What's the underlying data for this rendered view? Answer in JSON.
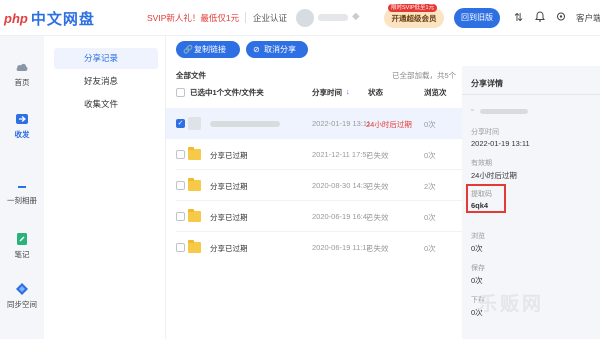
{
  "header": {
    "logo_php": "php",
    "logo_text": "中文网盘",
    "svip_promo": "SVIP新人礼！最低仅1元",
    "cert_label": "企业认证",
    "vip_button": "开通超级会员",
    "vip_tag": "限时SVIP低至1元",
    "back_button": "回到旧版",
    "client_label": "客户端"
  },
  "leftnav": {
    "items": [
      {
        "label": "首页",
        "icon": "cloud-icon"
      },
      {
        "label": "收发",
        "icon": "share-icon"
      },
      {
        "label": "一刻相册",
        "icon": "photo-icon"
      },
      {
        "label": "笔记",
        "icon": "note-icon"
      },
      {
        "label": "同步空间",
        "icon": "sync-icon"
      }
    ]
  },
  "subnav": {
    "items": [
      {
        "label": "分享记录",
        "active": true
      },
      {
        "label": "好友消息"
      },
      {
        "label": "收集文件"
      }
    ]
  },
  "toolbar": {
    "copy_link": "复制链接",
    "cancel_share": "取消分享"
  },
  "list": {
    "section_title": "全部文件",
    "loaded_text": "已全部加载，共5个",
    "headers": {
      "name": "已选中1个文件/文件夹",
      "time": "分享时间",
      "status": "状态",
      "views": "浏览次"
    },
    "rows": [
      {
        "name": "",
        "time": "2022-01-19 13:11",
        "status": "24小时后过期",
        "views": "0次"
      },
      {
        "name": "分享已过期",
        "time": "2021-12-11 17:57",
        "status": "已失效",
        "views": "0次"
      },
      {
        "name": "分享已过期",
        "time": "2020-08-30 14:37",
        "status": "已失效",
        "views": "2次"
      },
      {
        "name": "分享已过期",
        "time": "2020-06-19 16:47",
        "status": "已失效",
        "views": "0次"
      },
      {
        "name": "分享已过期",
        "time": "2020-06-19 11:13",
        "status": "已失效",
        "views": "0次"
      }
    ]
  },
  "detail": {
    "title": "分享详情",
    "share_time_label": "分享时间",
    "share_time": "2022-01-19 13:11",
    "valid_label": "有效期",
    "valid_value": "24小时后过期",
    "code_label": "提取码",
    "code_value": "6qk4",
    "views_label": "浏览",
    "views_value": "0次",
    "saves_label": "保存",
    "saves_value": "0次",
    "downloads_label": "下载",
    "downloads_value": "0次"
  },
  "watermark": "乐贩网"
}
